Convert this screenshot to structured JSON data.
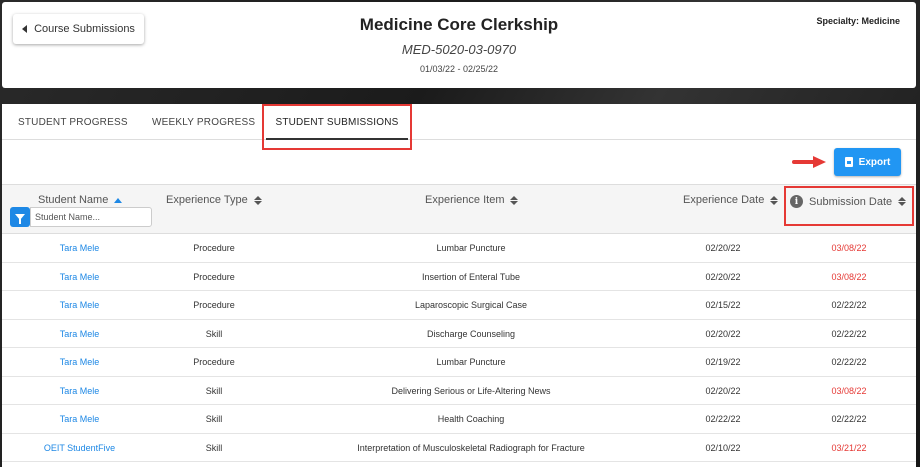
{
  "header": {
    "back_label": "Course Submissions",
    "title": "Medicine Core Clerkship",
    "code": "MED-5020-03-0970",
    "dates": "01/03/22 - 02/25/22",
    "specialty": "Specialty: Medicine"
  },
  "tabs": [
    {
      "label": "STUDENT PROGRESS",
      "active": false
    },
    {
      "label": "WEEKLY PROGRESS",
      "active": false
    },
    {
      "label": "STUDENT SUBMISSIONS",
      "active": true
    }
  ],
  "toolbar": {
    "export_label": "Export"
  },
  "table": {
    "columns": [
      "Student Name",
      "Experience Type",
      "Experience Item",
      "Experience Date",
      "Submission Date"
    ],
    "name_filter_placeholder": "Student Name...",
    "rows": [
      {
        "name": "Tara Mele",
        "type": "Procedure",
        "item": "Lumbar Puncture",
        "exp_date": "02/20/22",
        "sub_date": "03/08/22",
        "late": true
      },
      {
        "name": "Tara Mele",
        "type": "Procedure",
        "item": "Insertion of Enteral Tube",
        "exp_date": "02/20/22",
        "sub_date": "03/08/22",
        "late": true
      },
      {
        "name": "Tara Mele",
        "type": "Procedure",
        "item": "Laparoscopic Surgical Case",
        "exp_date": "02/15/22",
        "sub_date": "02/22/22",
        "late": false
      },
      {
        "name": "Tara Mele",
        "type": "Skill",
        "item": "Discharge Counseling",
        "exp_date": "02/20/22",
        "sub_date": "02/22/22",
        "late": false
      },
      {
        "name": "Tara Mele",
        "type": "Procedure",
        "item": "Lumbar Puncture",
        "exp_date": "02/19/22",
        "sub_date": "02/22/22",
        "late": false
      },
      {
        "name": "Tara Mele",
        "type": "Skill",
        "item": "Delivering Serious or Life-Altering News",
        "exp_date": "02/20/22",
        "sub_date": "03/08/22",
        "late": true
      },
      {
        "name": "Tara Mele",
        "type": "Skill",
        "item": "Health Coaching",
        "exp_date": "02/22/22",
        "sub_date": "02/22/22",
        "late": false
      },
      {
        "name": "OEIT StudentFive",
        "type": "Skill",
        "item": "Interpretation of Musculoskeletal Radiograph for Fracture",
        "exp_date": "02/10/22",
        "sub_date": "03/21/22",
        "late": true
      }
    ]
  },
  "colors": {
    "accent": "#2196f3",
    "link": "#1e88e5",
    "late": "#e53935",
    "highlight": "#e53935"
  }
}
